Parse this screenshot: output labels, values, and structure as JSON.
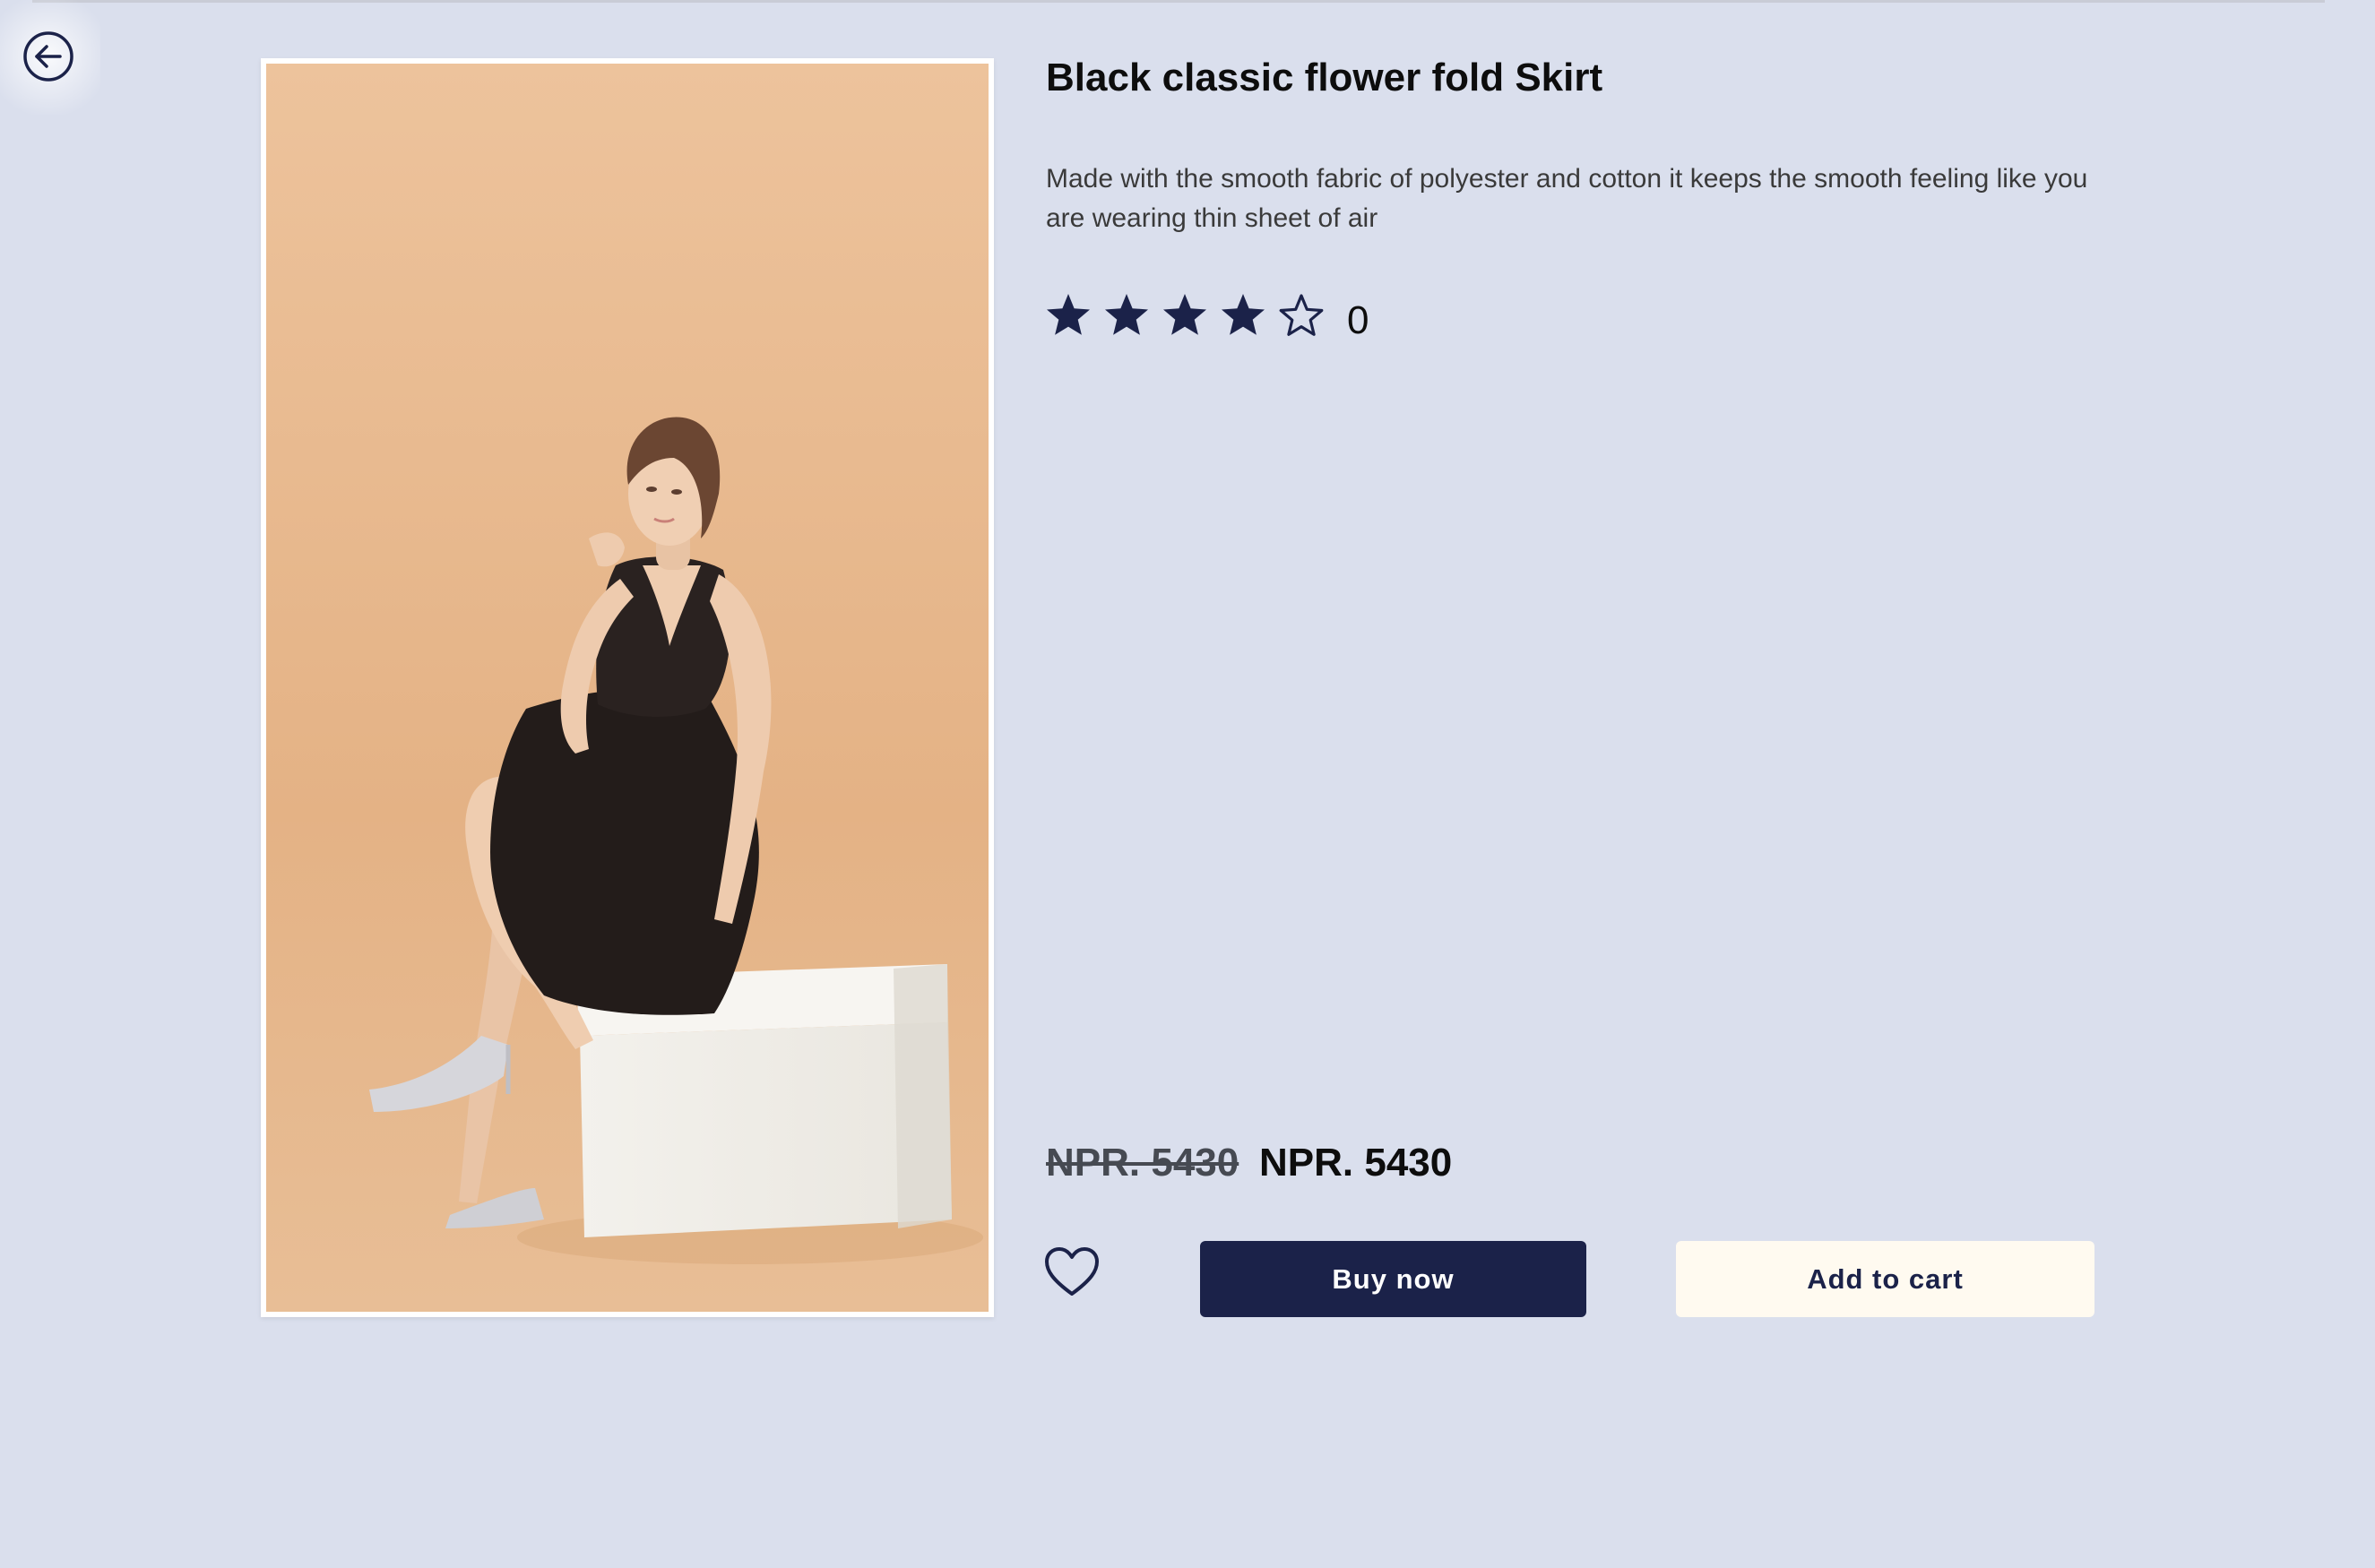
{
  "product": {
    "title": "Black classic flower fold Skirt",
    "description": "Made with the smooth fabric of polyester and cotton it keeps the smooth feeling like you are wearing thin sheet of air",
    "rating": {
      "stars_filled": 4,
      "stars_total": 5,
      "count": "0"
    },
    "price": {
      "original": "NPR. 5430",
      "current": "NPR. 5430"
    }
  },
  "actions": {
    "buy_label": "Buy now",
    "cart_label": "Add to cart"
  },
  "icons": {
    "back": "back-arrow-icon",
    "wishlist": "heart-icon",
    "star_filled": "star-filled-icon",
    "star_empty": "star-outline-icon"
  },
  "colors": {
    "background": "#dadfed",
    "accent": "#1b2249",
    "cart_button_bg": "#fffaf0",
    "photo_backdrop": "#e8b98e"
  }
}
